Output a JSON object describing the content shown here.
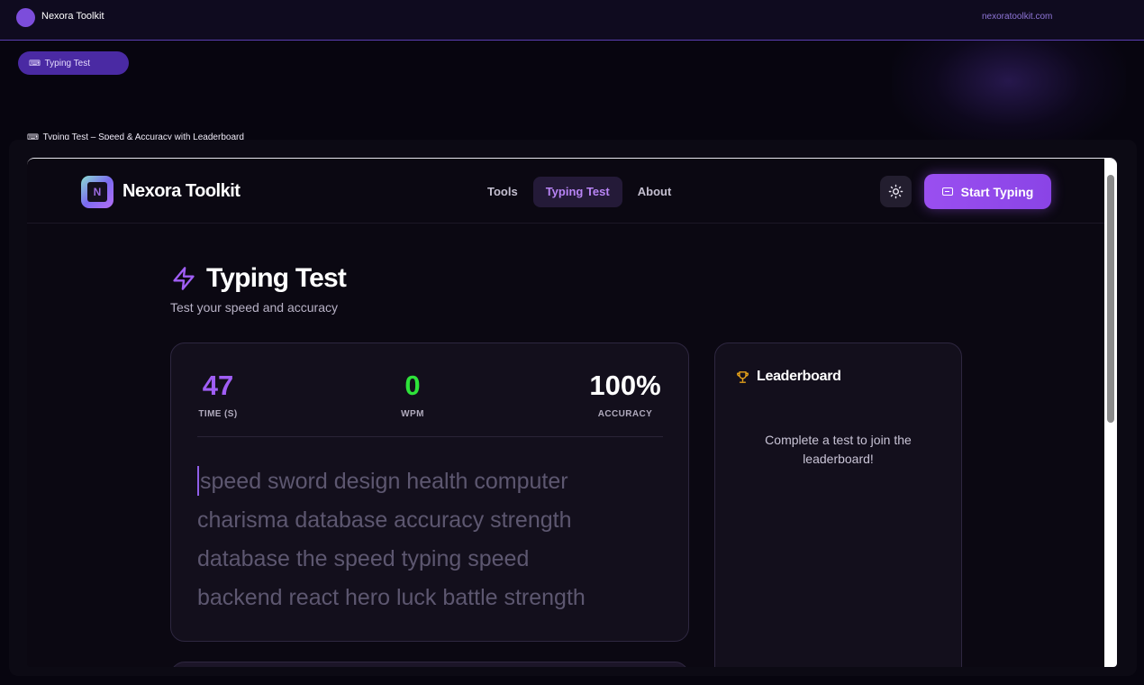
{
  "outer": {
    "app_title": "Nexora Toolkit",
    "url": "nexoratoolkit.com",
    "tab_label": "Typing Test",
    "caption": "Typing Test – Speed & Accuracy with Leaderboard"
  },
  "header": {
    "brand": "Nexora Toolkit",
    "nav": [
      "Tools",
      "Typing Test",
      "About"
    ],
    "active_nav": "Typing Test",
    "cta_label": "Start Typing"
  },
  "page": {
    "title": "Typing Test",
    "subtitle": "Test your speed and accuracy"
  },
  "stats": {
    "time": {
      "value": "47",
      "label": "TIME (S)"
    },
    "wpm": {
      "value": "0",
      "label": "WPM"
    },
    "accuracy": {
      "value": "100%",
      "label": "ACCURACY"
    }
  },
  "typing": {
    "lines": [
      "speed sword design health computer",
      "charisma database accuracy strength",
      "database the speed typing speed",
      "backend react hero luck battle strength"
    ]
  },
  "leaderboard": {
    "title": "Leaderboard",
    "empty_message": "Complete a test to join the leaderboard!"
  },
  "colors": {
    "accent": "#9a4ff0",
    "time": "#a05ef5",
    "wpm": "#2ee23a",
    "trophy": "#e6a21a"
  },
  "icons": {
    "theme": "sun-icon",
    "cta": "keyboard-icon",
    "title": "lightning-icon",
    "leaderboard": "trophy-icon"
  }
}
